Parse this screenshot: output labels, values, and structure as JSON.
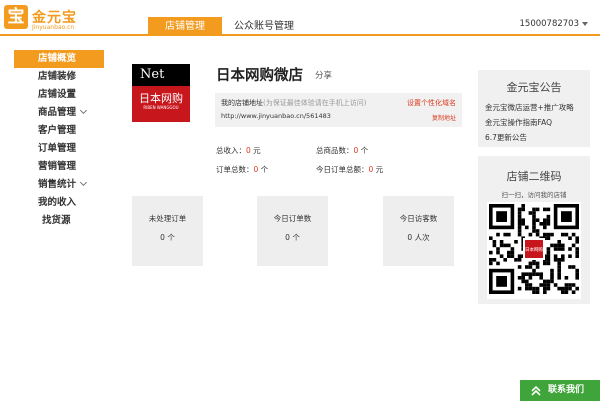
{
  "header": {
    "logo_glyph": "宝",
    "logo_name": "金元宝",
    "logo_domain": "Jinyuanbao.cn",
    "tabs": [
      {
        "label": "店铺管理",
        "active": true
      },
      {
        "label": "公众账号管理",
        "active": false
      }
    ],
    "account": "15000782703"
  },
  "sidebar": {
    "items": [
      {
        "label": "店铺概览",
        "active": true
      },
      {
        "label": "店铺装修"
      },
      {
        "label": "店铺设置"
      },
      {
        "label": "商品管理",
        "expand": true
      },
      {
        "label": "客户管理"
      },
      {
        "label": "订单管理"
      },
      {
        "label": "营销管理"
      },
      {
        "label": "销售统计",
        "expand": true
      },
      {
        "label": "我的收入"
      },
      {
        "label": "找货源"
      }
    ]
  },
  "shop": {
    "logo_top": "Net",
    "logo_main": "日本网购",
    "logo_sub": "RIBEN WANGGOU",
    "name": "日本网购微店",
    "share": "分享",
    "address_label": "我的店铺地址",
    "address_hint": "(为保证最佳体验请在手机上访问)",
    "custom_domain": "设置个性化域名",
    "url": "http://www.jinyuanbao.cn/561483",
    "copy": "复制地址"
  },
  "stats": {
    "total_income_label": "总收入：",
    "total_income": "0",
    "total_income_unit": "元",
    "total_goods_label": "总商品数：",
    "total_goods": "0",
    "total_goods_unit": "个",
    "total_orders_label": "订单总数：",
    "total_orders": "0",
    "total_orders_unit": "个",
    "today_amount_label": "今日订单总额：",
    "today_amount": "0",
    "today_amount_unit": "元"
  },
  "cards": [
    {
      "title": "未处理订单",
      "value": "0 个"
    },
    {
      "title": "今日订单数",
      "value": "0 个"
    },
    {
      "title": "今日访客数",
      "value": "0 人次"
    }
  ],
  "notice": {
    "title": "金元宝公告",
    "links": [
      "金元宝微店运营+推广攻略",
      "金元宝操作指南FAQ",
      "6.7更新公告"
    ]
  },
  "qrcode": {
    "title": "店铺二维码",
    "subtitle": "扫一扫，访问我的店铺",
    "center_label": "日本网购"
  },
  "contact": {
    "label": "联系我们",
    "color": "#3fa43a"
  },
  "colors": {
    "accent": "#f29b1f",
    "highlight": "#d93a1e"
  }
}
